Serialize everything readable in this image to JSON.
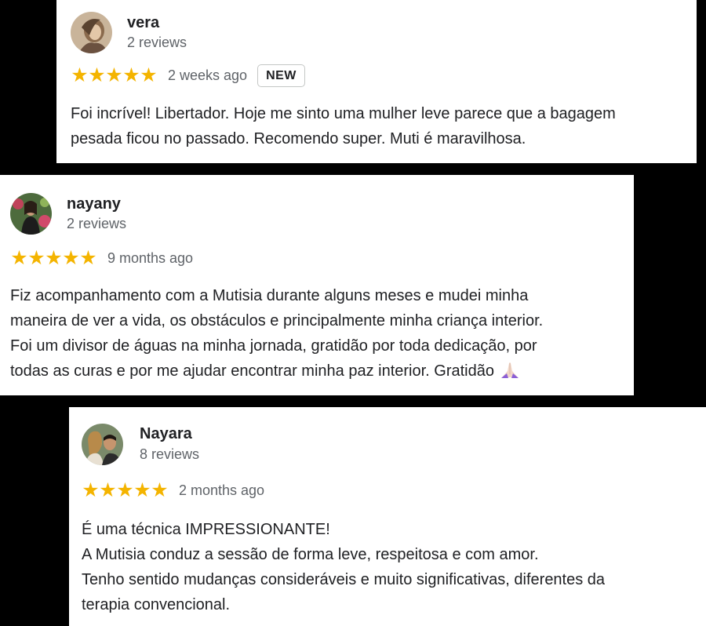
{
  "reviews": [
    {
      "name": "vera",
      "review_count": "2 reviews",
      "rating": 5,
      "stars": "★★★★★",
      "date": "2 weeks ago",
      "badge": "NEW",
      "lines": [
        "Foi incrível! Libertador. Hoje me sinto uma mulher leve parece que a bagagem",
        "pesada ficou no passado. Recomendo super. Muti é maravilhosa."
      ]
    },
    {
      "name": "nayany",
      "review_count": "2 reviews",
      "rating": 5,
      "stars": "★★★★★",
      "date": "9 months ago",
      "lines": [
        "Fiz acompanhamento com a Mutisia durante alguns meses e mudei minha",
        "maneira de ver a vida, os obstáculos e principalmente minha criança interior.",
        "Foi um divisor de águas na minha jornada, gratidão por toda dedicação, por",
        "todas as curas e por me ajudar encontrar minha paz interior. Gratidão"
      ],
      "trailing_emoji": "praying-hands-emoji"
    },
    {
      "name": "Nayara",
      "review_count": "8 reviews",
      "rating": 5,
      "stars": "★★★★★",
      "date": "2 months ago",
      "lines": [
        "É uma técnica IMPRESSIONANTE!",
        "A Mutisia conduz a sessão de forma leve, respeitosa e com amor.",
        "Tenho sentido mudanças consideráveis e muito significativas, diferentes da",
        "terapia convencional."
      ]
    }
  ],
  "colors": {
    "background": "#000000",
    "card": "#ffffff",
    "star": "#f4b400",
    "name": "#202124",
    "secondary": "#5f6368"
  }
}
